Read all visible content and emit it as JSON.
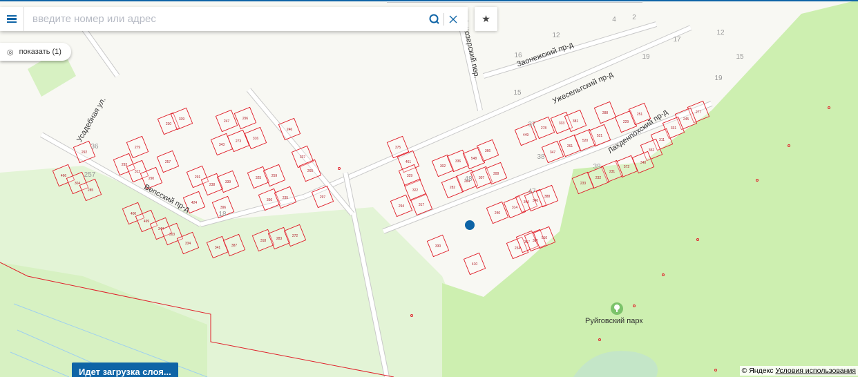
{
  "search": {
    "placeholder": "введите номер или адрес",
    "value": "",
    "search_icon": "search-icon",
    "clear_icon": "close-icon"
  },
  "menu_icon": "hamburger-icon",
  "favorites_icon": "star-icon",
  "show_button": {
    "label": "показать (1)",
    "icon": "eye-icon"
  },
  "loading_label": "Идет загрузка слоя...",
  "copyright": {
    "text": "© Яндекс",
    "link": "Условия использования"
  },
  "colors": {
    "accent": "#0e64a6",
    "parcel": "#e0202a",
    "green": "#cdefb0",
    "marker": "#0e64a6"
  },
  "streets": [
    "Усадебная ул.",
    "Вепсский пр-д",
    "Панозерский пер.",
    "Заонежский пр-д",
    "Ужесельгский пр-д",
    "Лахденпохский пр-д"
  ],
  "park": {
    "label": "Руйговский парк",
    "icon": "tree-icon"
  },
  "block_numbers": [
    "36",
    "257",
    "18",
    "48",
    "37",
    "38",
    "39",
    "47",
    "4",
    "2",
    "12",
    "16",
    "15",
    "17",
    "19",
    "12",
    "15",
    "19"
  ],
  "parcels": [
    "466",
    "304",
    "285",
    "292",
    "279",
    "293",
    "312",
    "290",
    "257",
    "230",
    "339",
    "247",
    "296",
    "343",
    "273",
    "316",
    "246",
    "291",
    "238",
    "339",
    "424",
    "396",
    "325",
    "259",
    "356",
    "235",
    "337",
    "265",
    "297",
    "400",
    "499",
    "344",
    "303",
    "334",
    "341",
    "387",
    "318",
    "283",
    "272",
    "375",
    "461",
    "329",
    "322",
    "294",
    "317",
    "302",
    "336",
    "548",
    "366",
    "282",
    "284",
    "307",
    "308",
    "240",
    "314",
    "348",
    "340",
    "388",
    "330",
    "410",
    "234",
    "367",
    "387",
    "510",
    "449",
    "278",
    "347",
    "333",
    "381",
    "261",
    "520",
    "521",
    "229",
    "251",
    "288",
    "277",
    "245",
    "331",
    "311",
    "352",
    "340",
    "572",
    "231",
    "232",
    "233"
  ]
}
